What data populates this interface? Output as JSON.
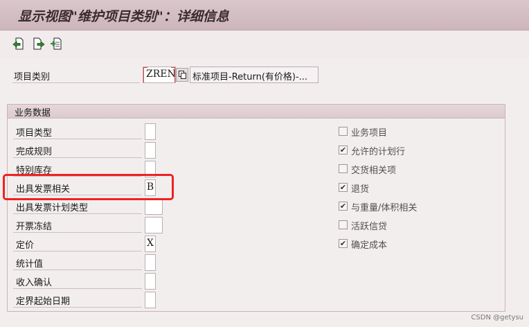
{
  "window": {
    "title": "显示视图\"维护项目类别\"：详细信息"
  },
  "toolbar": {
    "buttons": [
      "previous-entry-icon",
      "next-entry-icon",
      "other-entry-icon"
    ]
  },
  "header": {
    "item_category_label": "项目类别",
    "item_category_value": "ZREN",
    "item_category_desc": "标准项目-Return(有价格)-..."
  },
  "group": {
    "title": "业务数据",
    "fields": [
      {
        "label": "项目类型",
        "value": ""
      },
      {
        "label": "完成规则",
        "value": ""
      },
      {
        "label": "特别库存",
        "value": ""
      },
      {
        "label": "出具发票相关",
        "value": "B"
      },
      {
        "label": "出具发票计划类型",
        "value": ""
      },
      {
        "label": "开票冻结",
        "value": ""
      },
      {
        "label": "定价",
        "value": "X"
      },
      {
        "label": "统计值",
        "value": ""
      },
      {
        "label": "收入确认",
        "value": ""
      },
      {
        "label": "定界起始日期",
        "value": ""
      }
    ],
    "checkboxes": [
      {
        "label": "业务项目",
        "checked": false
      },
      {
        "label": "允许的计划行",
        "checked": true
      },
      {
        "label": "交货相关项",
        "checked": false
      },
      {
        "label": "退货",
        "checked": true
      },
      {
        "label": "与重量/体积相关",
        "checked": true
      },
      {
        "label": "活跃信贷",
        "checked": false
      },
      {
        "label": "确定成本",
        "checked": true
      }
    ]
  },
  "watermark": "CSDN @getysu",
  "colors": {
    "highlight": "#ee2222",
    "titlebar": "#d9c7cb"
  }
}
